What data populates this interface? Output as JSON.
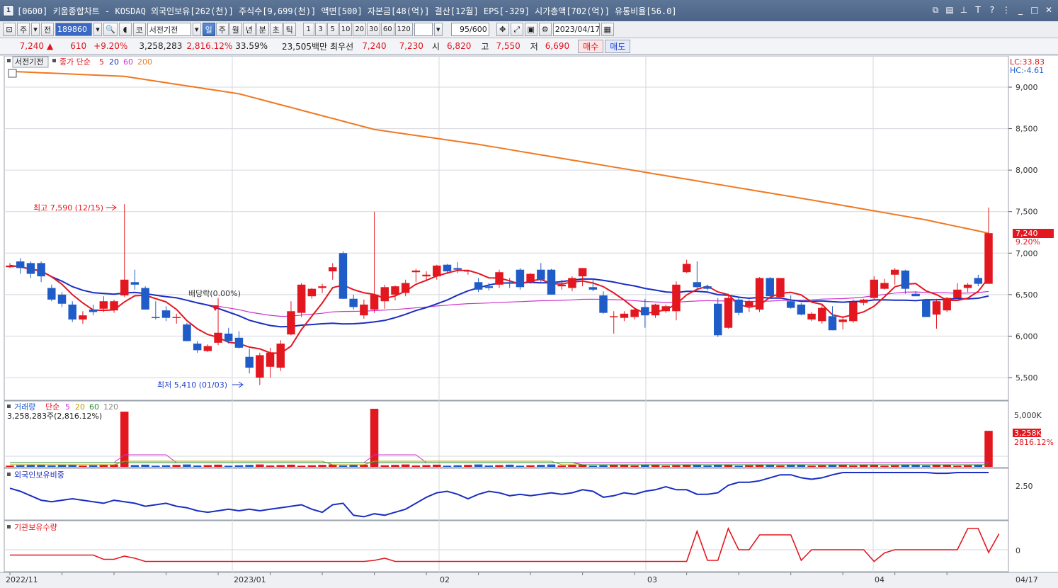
{
  "window": {
    "title": "[0600] 키움종합차트 - KOSDAQ 외국인보유[262(천)] 주식수[9,699(천)] 액면[500] 자본금[48(억)] 결산[12월] EPS[-329] 시가총액[702(억)] 유통비율[56.0]",
    "app_badge": "1"
  },
  "toolbar": {
    "period_btn": "주",
    "prev_btn": "전",
    "code": "189860",
    "market_btn": "코",
    "stock_name": "서전기전",
    "tabs": [
      "일",
      "주",
      "월",
      "년",
      "분",
      "초",
      "틱"
    ],
    "active_tab": "일",
    "intervals": [
      "1",
      "3",
      "5",
      "10",
      "20",
      "30",
      "60",
      "120"
    ],
    "count_value": "95",
    "count_total": "/600",
    "date": "2023/04/17"
  },
  "quote": {
    "price": "7,240",
    "arrow": "▲",
    "change": "610",
    "change_pct": "+9.20%",
    "volume": "3,258,283",
    "volume_pct": "2,816.12%",
    "turnover": "33.59%",
    "amount": "23,505백만",
    "best_label": "최우선",
    "best_ask": "7,240",
    "best_bid": "7,230",
    "open_label": "시",
    "open": "6,820",
    "high_label": "고",
    "high": "7,550",
    "low_label": "저",
    "low": "6,690",
    "buy_btn": "매수",
    "sell_btn": "매도"
  },
  "price_panel": {
    "stock_label": "서전기전",
    "legend_prefix": "종가 단순",
    "ma_labels": [
      "5",
      "20",
      "60",
      "200"
    ],
    "lc": "LC:33.83",
    "hc": "HC:-4.61",
    "y_ticks": [
      "9,000",
      "8,500",
      "8,000",
      "7,500",
      "7,000",
      "6,500",
      "6,000",
      "5,500"
    ],
    "current_price_tag": "7,240",
    "current_pct_tag": "9.20%",
    "high_note": "최고 7,590 (12/15)",
    "low_note": "최저 5,410 (01/03)",
    "dividend_note": "배당락(0.00%)"
  },
  "volume_panel": {
    "label": "거래량",
    "legend_prefix": "단순",
    "ma_labels": [
      "5",
      "20",
      "60",
      "120"
    ],
    "info": "3,258,283주(2,816.12%)",
    "y_tick": "5,000K",
    "current_tag": "3,258K",
    "current_pct": "2816.12%"
  },
  "foreign_panel": {
    "label": "외국인보유비중",
    "y_tick": "2.50"
  },
  "inst_panel": {
    "label": "기관보유수량",
    "y_tick": "0"
  },
  "x_axis": [
    "2022/11",
    "2023/01",
    "02",
    "03",
    "04",
    "04/17"
  ],
  "colors": {
    "up": "#e3171f",
    "down": "#1f5cc8",
    "ma5": "#e3171f",
    "ma20": "#1a2ec2",
    "ma60": "#cc33cc",
    "ma200": "#f07820"
  },
  "chart_data": {
    "type": "candlestick",
    "ylim": [
      5300,
      9400
    ],
    "candles": [
      [
        6830,
        6880,
        6820,
        6850
      ],
      [
        6900,
        6940,
        6750,
        6820
      ],
      [
        6880,
        6900,
        6700,
        6750
      ],
      [
        6880,
        6900,
        6650,
        6720
      ],
      [
        6580,
        6620,
        6420,
        6440
      ],
      [
        6500,
        6530,
        6350,
        6390
      ],
      [
        6380,
        6420,
        6170,
        6200
      ],
      [
        6200,
        6300,
        6150,
        6250
      ],
      [
        6320,
        6380,
        6250,
        6290
      ],
      [
        6330,
        6480,
        6290,
        6420
      ],
      [
        6310,
        6440,
        6280,
        6420
      ],
      [
        6490,
        7590,
        6470,
        6680
      ],
      [
        6650,
        6800,
        6560,
        6620
      ],
      [
        6580,
        6600,
        6320,
        6320
      ],
      [
        6230,
        6420,
        6200,
        6220
      ],
      [
        6310,
        6360,
        6180,
        6220
      ],
      [
        6220,
        6270,
        6150,
        6230
      ],
      [
        6140,
        6160,
        5940,
        5940
      ],
      [
        5910,
        5940,
        5800,
        5830
      ],
      [
        5820,
        5900,
        5810,
        5880
      ],
      [
        5920,
        6460,
        5890,
        6040
      ],
      [
        6030,
        6100,
        5910,
        5940
      ],
      [
        5980,
        6060,
        5850,
        5860
      ],
      [
        5750,
        5850,
        5550,
        5620
      ],
      [
        5500,
        5800,
        5410,
        5770
      ],
      [
        5630,
        5860,
        5500,
        5800
      ],
      [
        5620,
        5950,
        5580,
        5910
      ],
      [
        6020,
        6420,
        6010,
        6300
      ],
      [
        6280,
        6640,
        6230,
        6620
      ],
      [
        6480,
        6580,
        6450,
        6570
      ],
      [
        6580,
        6630,
        6520,
        6600
      ],
      [
        6780,
        6880,
        6680,
        6830
      ],
      [
        7000,
        7020,
        6450,
        6450
      ],
      [
        6450,
        6500,
        6320,
        6350
      ],
      [
        6250,
        6440,
        6210,
        6380
      ],
      [
        6320,
        7500,
        6280,
        6500
      ],
      [
        6420,
        6620,
        6330,
        6590
      ],
      [
        6500,
        6610,
        6430,
        6600
      ],
      [
        6520,
        6680,
        6480,
        6640
      ],
      [
        6770,
        6810,
        6650,
        6790
      ],
      [
        6720,
        6780,
        6660,
        6740
      ],
      [
        6720,
        6860,
        6680,
        6850
      ],
      [
        6860,
        6870,
        6750,
        6780
      ],
      [
        6820,
        6890,
        6760,
        6800
      ],
      [
        6790,
        6800,
        6740,
        6790
      ],
      [
        6650,
        6700,
        6530,
        6560
      ],
      [
        6600,
        6640,
        6550,
        6580
      ],
      [
        6620,
        6800,
        6580,
        6770
      ],
      [
        6650,
        6700,
        6580,
        6630
      ],
      [
        6800,
        6820,
        6560,
        6590
      ],
      [
        6650,
        6760,
        6630,
        6750
      ],
      [
        6800,
        6880,
        6640,
        6680
      ],
      [
        6800,
        6810,
        6500,
        6500
      ],
      [
        6600,
        6680,
        6560,
        6620
      ],
      [
        6580,
        6720,
        6540,
        6700
      ],
      [
        6720,
        6820,
        6600,
        6820
      ],
      [
        6590,
        6690,
        6540,
        6560
      ],
      [
        6490,
        6540,
        6270,
        6280
      ],
      [
        6240,
        6300,
        6030,
        6240
      ],
      [
        6220,
        6300,
        6180,
        6270
      ],
      [
        6230,
        6330,
        6200,
        6320
      ],
      [
        6350,
        6450,
        6100,
        6250
      ],
      [
        6250,
        6390,
        6220,
        6380
      ],
      [
        6300,
        6380,
        6280,
        6360
      ],
      [
        6300,
        6660,
        6190,
        6620
      ],
      [
        6770,
        6920,
        6760,
        6870
      ],
      [
        6650,
        6900,
        6560,
        6590
      ],
      [
        6600,
        6620,
        6550,
        6570
      ],
      [
        6390,
        6460,
        5990,
        6010
      ],
      [
        6100,
        6510,
        6090,
        6460
      ],
      [
        6440,
        6480,
        6250,
        6280
      ],
      [
        6360,
        6440,
        6290,
        6420
      ],
      [
        6320,
        6710,
        6290,
        6700
      ],
      [
        6700,
        6710,
        6490,
        6480
      ],
      [
        6470,
        6700,
        6450,
        6700
      ],
      [
        6420,
        6490,
        6330,
        6340
      ],
      [
        6380,
        6400,
        6250,
        6260
      ],
      [
        6200,
        6290,
        6180,
        6270
      ],
      [
        6180,
        6390,
        6150,
        6340
      ],
      [
        6240,
        6360,
        6070,
        6070
      ],
      [
        6170,
        6230,
        6080,
        6200
      ],
      [
        6180,
        6440,
        6160,
        6410
      ],
      [
        6400,
        6450,
        6370,
        6440
      ],
      [
        6460,
        6720,
        6430,
        6680
      ],
      [
        6570,
        6690,
        6560,
        6640
      ],
      [
        6740,
        6820,
        6620,
        6800
      ],
      [
        6790,
        6800,
        6510,
        6570
      ],
      [
        6510,
        6540,
        6490,
        6480
      ],
      [
        6430,
        6450,
        6260,
        6230
      ],
      [
        6260,
        6450,
        6090,
        6420
      ],
      [
        6310,
        6470,
        6290,
        6460
      ],
      [
        6460,
        6640,
        6460,
        6560
      ],
      [
        6580,
        6640,
        6530,
        6620
      ],
      [
        6700,
        6740,
        6600,
        6630
      ],
      [
        6630,
        7550,
        6690,
        7240
      ]
    ],
    "volume_spikes": {
      "11": 0.95,
      "35": 1.0,
      "94": 0.62
    },
    "foreign_ratio": [
      2.48,
      2.46,
      2.43,
      2.4,
      2.39,
      2.4,
      2.41,
      2.4,
      2.39,
      2.38,
      2.4,
      2.39,
      2.38,
      2.36,
      2.37,
      2.38,
      2.36,
      2.35,
      2.33,
      2.32,
      2.33,
      2.34,
      2.33,
      2.34,
      2.33,
      2.34,
      2.35,
      2.36,
      2.37,
      2.34,
      2.32,
      2.37,
      2.38,
      2.3,
      2.29,
      2.31,
      2.3,
      2.32,
      2.34,
      2.38,
      2.42,
      2.45,
      2.46,
      2.44,
      2.41,
      2.44,
      2.46,
      2.45,
      2.43,
      2.44,
      2.43,
      2.44,
      2.45,
      2.44,
      2.45,
      2.47,
      2.46,
      2.42,
      2.43,
      2.45,
      2.44,
      2.46,
      2.47,
      2.49,
      2.47,
      2.47,
      2.44,
      2.44,
      2.45,
      2.5,
      2.52,
      2.52,
      2.53,
      2.55,
      2.57,
      2.57,
      2.55,
      2.54,
      2.55,
      2.57,
      2.59,
      2.6,
      2.59,
      2.59,
      2.61,
      2.62,
      2.62,
      2.59,
      2.59,
      2.58,
      2.58,
      2.64,
      2.68,
      2.7,
      2.66
    ],
    "institution": [
      -0.1,
      -0.1,
      -0.1,
      -0.1,
      -0.1,
      -0.1,
      -0.1,
      -0.1,
      -0.1,
      -0.18,
      -0.18,
      -0.12,
      -0.16,
      -0.22,
      -0.22,
      -0.22,
      -0.22,
      -0.22,
      -0.22,
      -0.22,
      -0.22,
      -0.22,
      -0.22,
      -0.22,
      -0.22,
      -0.22,
      -0.22,
      -0.22,
      -0.22,
      -0.22,
      -0.22,
      -0.22,
      -0.22,
      -0.22,
      -0.22,
      -0.2,
      -0.16,
      -0.22,
      -0.22,
      -0.22,
      -0.22,
      -0.22,
      -0.22,
      -0.22,
      -0.22,
      -0.22,
      -0.22,
      -0.22,
      -0.22,
      -0.22,
      -0.22,
      -0.22,
      -0.22,
      -0.22,
      -0.22,
      -0.22,
      -0.22,
      -0.22,
      -0.22,
      -0.22,
      -0.22,
      -0.22,
      -0.22,
      -0.22,
      -0.22,
      -0.22,
      0.35,
      -0.2,
      -0.2,
      0.4,
      0.0,
      0.0,
      0.28,
      0.28,
      0.28,
      0.28,
      -0.2,
      0.0,
      0.0,
      0.0,
      0.0,
      0.0,
      0.0,
      -0.22,
      -0.06,
      0.0,
      0.0,
      0.0,
      0.0,
      0.0,
      0.0,
      0.0,
      0.4,
      0.4,
      -0.05,
      0.3
    ]
  }
}
